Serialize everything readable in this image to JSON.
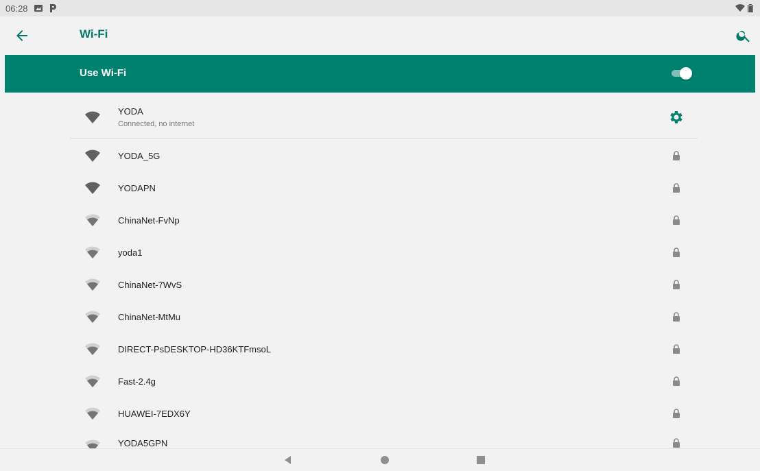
{
  "status_bar": {
    "time": "06:28",
    "left_icons": [
      "image-notification-icon",
      "p-notification-icon"
    ],
    "right_icons": [
      "wifi-status-icon",
      "battery-icon"
    ]
  },
  "app_bar": {
    "title": "Wi-Fi",
    "back_icon": "arrow-back-icon",
    "search_icon": "search-icon"
  },
  "master_switch": {
    "label": "Use Wi-Fi",
    "state": "on"
  },
  "connected_network": {
    "ssid": "YODA",
    "status": "Connected, no internet",
    "signal": "full",
    "settings_icon": "gear-icon"
  },
  "networks": [
    {
      "ssid": "YODA_5G",
      "signal": "full",
      "secured": true
    },
    {
      "ssid": "YODAPN",
      "signal": "full",
      "secured": true
    },
    {
      "ssid": "ChinaNet-FvNp",
      "signal": "medium",
      "secured": true
    },
    {
      "ssid": "yoda1",
      "signal": "medium",
      "secured": true
    },
    {
      "ssid": "ChinaNet-7WvS",
      "signal": "medium",
      "secured": true
    },
    {
      "ssid": "ChinaNet-MtMu",
      "signal": "medium",
      "secured": true
    },
    {
      "ssid": "DIRECT-PsDESKTOP-HD36KTFmsoL",
      "signal": "medium",
      "secured": true
    },
    {
      "ssid": "Fast-2.4g",
      "signal": "medium",
      "secured": true
    },
    {
      "ssid": "HUAWEI-7EDX6Y",
      "signal": "medium",
      "secured": true
    },
    {
      "ssid": "YODA5GPN",
      "signal": "medium",
      "secured": true
    }
  ],
  "nav_bar": [
    "back-triangle-icon",
    "home-circle-icon",
    "recents-square-icon"
  ],
  "colors": {
    "accent": "#00806e",
    "title": "#00796b",
    "background": "#f2f2f2"
  }
}
